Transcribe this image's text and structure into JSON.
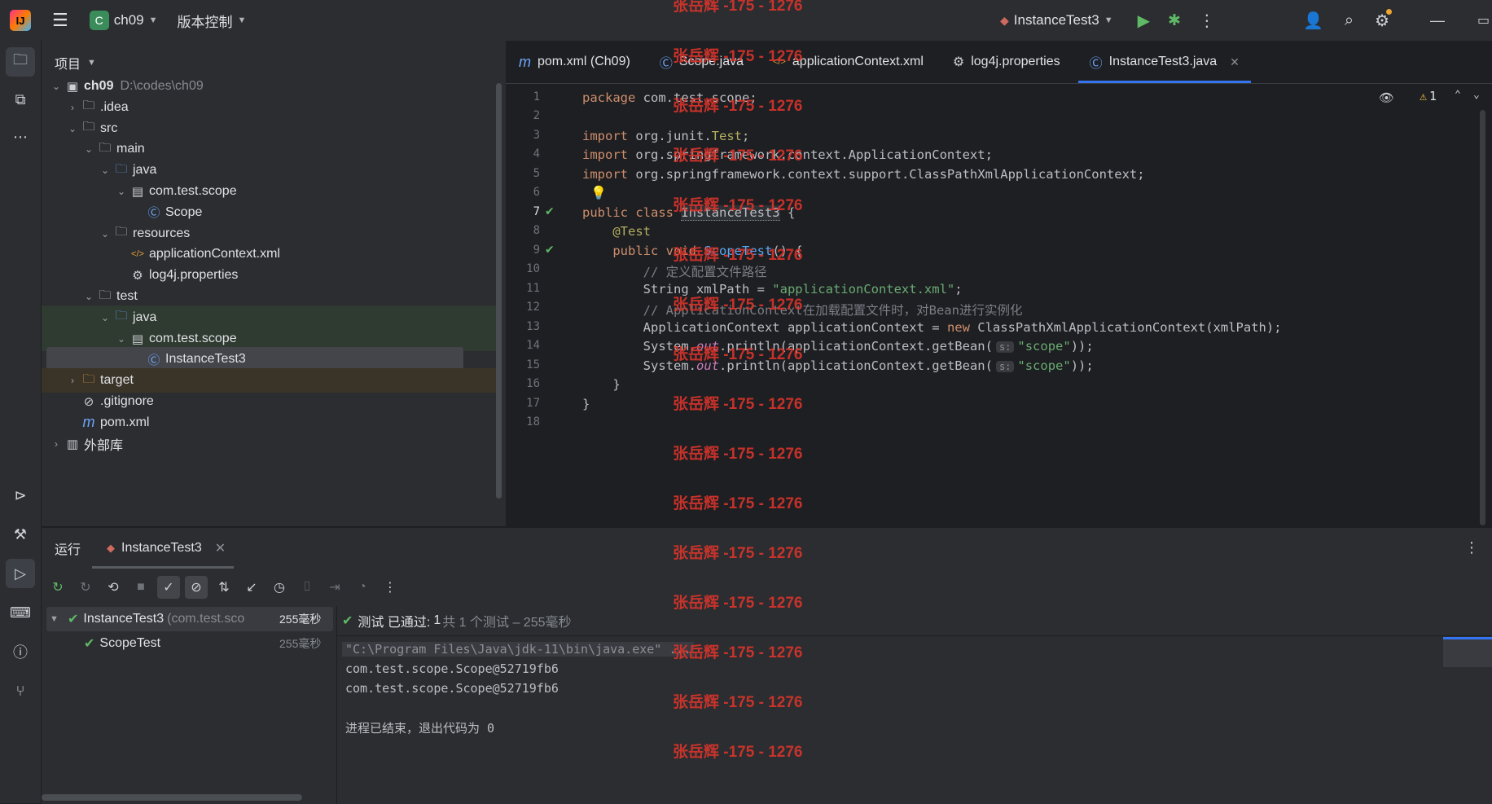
{
  "titlebar": {
    "project_name": "ch09",
    "project_badge": "C",
    "vcs_label": "版本控制",
    "run_config": "InstanceTest3"
  },
  "project_panel": {
    "title": "项目",
    "tree": [
      {
        "label": "ch09",
        "extra": "D:\\codes\\ch09",
        "icon": "module-folder-icon",
        "indent": 0,
        "arrow": "down"
      },
      {
        "label": ".idea",
        "icon": "folder-icon",
        "indent": 1,
        "arrow": "right"
      },
      {
        "label": "src",
        "icon": "folder-icon",
        "indent": 1,
        "arrow": "down"
      },
      {
        "label": "main",
        "icon": "folder-icon",
        "indent": 2,
        "arrow": "down"
      },
      {
        "label": "java",
        "icon": "source-folder-icon",
        "indent": 3,
        "arrow": "down"
      },
      {
        "label": "com.test.scope",
        "icon": "package-icon",
        "indent": 4,
        "arrow": "down"
      },
      {
        "label": "Scope",
        "icon": "class-icon",
        "indent": 5,
        "arrow": ""
      },
      {
        "label": "resources",
        "icon": "resources-folder-icon",
        "indent": 3,
        "arrow": "down"
      },
      {
        "label": "applicationContext.xml",
        "icon": "xml-icon",
        "indent": 4,
        "arrow": ""
      },
      {
        "label": "log4j.properties",
        "icon": "properties-icon",
        "indent": 4,
        "arrow": ""
      },
      {
        "label": "test",
        "icon": "folder-icon",
        "indent": 2,
        "arrow": "down"
      },
      {
        "label": "java",
        "icon": "test-folder-icon",
        "indent": 3,
        "arrow": "down"
      },
      {
        "label": "com.test.scope",
        "icon": "package-icon",
        "indent": 4,
        "arrow": "down"
      },
      {
        "label": "InstanceTest3",
        "icon": "class-icon",
        "indent": 5,
        "arrow": "",
        "selected": true
      },
      {
        "label": "target",
        "icon": "excluded-folder-icon",
        "indent": 1,
        "arrow": "right"
      },
      {
        "label": ".gitignore",
        "icon": "ignore-file-icon",
        "indent": 1,
        "arrow": ""
      },
      {
        "label": "pom.xml",
        "icon": "maven-icon",
        "indent": 1,
        "arrow": ""
      },
      {
        "label": "外部库",
        "icon": "library-icon",
        "indent": 0,
        "arrow": "right"
      }
    ]
  },
  "editor": {
    "tabs": [
      {
        "label": "pom.xml (Ch09)",
        "icon": "maven-icon"
      },
      {
        "label": "Scope.java",
        "icon": "class-icon"
      },
      {
        "label": "applicationContext.xml",
        "icon": "xml-icon"
      },
      {
        "label": "log4j.properties",
        "icon": "properties-icon"
      },
      {
        "label": "InstanceTest3.java",
        "icon": "class-icon",
        "active": true
      }
    ],
    "warning_count": "1",
    "line_numbers": [
      "1",
      "2",
      "3",
      "4",
      "5",
      "6",
      "7",
      "8",
      "9",
      "10",
      "11",
      "12",
      "13",
      "14",
      "15",
      "16",
      "17",
      "18"
    ],
    "param_hint": "s:"
  },
  "run_panel": {
    "title": "运行",
    "tab_label": "InstanceTest3",
    "test_tree": [
      {
        "name": "InstanceTest3",
        "detail": "(com.test.sco",
        "time": "255毫秒"
      },
      {
        "name": "ScopeTest",
        "detail": "",
        "time": "255毫秒"
      }
    ],
    "status_prefix": "测试 已通过:",
    "status_count": "1",
    "status_detail": "共 1 个测试 – 255毫秒",
    "console": [
      "\"C:\\Program Files\\Java\\jdk-11\\bin\\java.exe\" ...",
      "com.test.scope.Scope@52719fb6",
      "com.test.scope.Scope@52719fb6",
      "",
      "进程已结束，退出代码为 0"
    ]
  },
  "watermark": "张岳辉 -175 - 1276",
  "colors": {
    "accent": "#3574f0",
    "pass_green": "#5fb865",
    "watermark_red": "#d9342b"
  }
}
